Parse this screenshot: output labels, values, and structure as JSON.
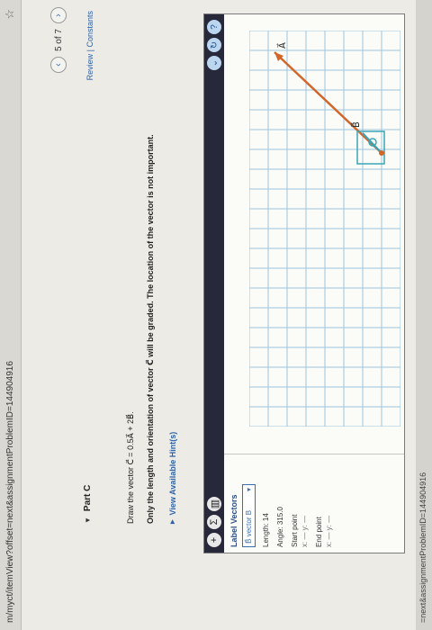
{
  "browser": {
    "url": "m/myct/itemView?offset=next&assignmentProblemID=144904916",
    "status_url": "=next&assignmentProblemID=144904916"
  },
  "paging": {
    "label": "5 of 7",
    "prev": "‹",
    "next": "›"
  },
  "header": {
    "review_label": "Review | Constants"
  },
  "part": {
    "label": "Part C"
  },
  "instructions": {
    "line1": "Draw the vector C⃗ = 0.5A⃗ + 2B⃗.",
    "line2": "Only the length and orientation of vector C⃗ will be graded. The location of the vector is not important.",
    "hint": "View Available Hint(s)"
  },
  "tool": {
    "toolbar_icons": [
      "plus-icon",
      "sum-icon",
      "trash-icon"
    ],
    "right_icons": [
      "chevron-down-icon",
      "reset-icon",
      "help-icon"
    ],
    "label_vectors": "Label Vectors",
    "selected_vector": "B⃗  vector B",
    "length": "Length: 14",
    "angle": "Angle: 315.0",
    "start_point": "Start point",
    "start_coords": "x: —  y: —",
    "end_point": "End point",
    "end_coords": "x: —  y: —"
  },
  "vectors": [
    {
      "name": "A⃗",
      "color": "#d2662a"
    },
    {
      "name": "B⃗",
      "color": "#3aa6b5"
    }
  ],
  "colors": {
    "toolbar": "#27283a",
    "link": "#2f62a6",
    "vectorA": "#d2662a",
    "vectorB": "#3aa6b5"
  }
}
